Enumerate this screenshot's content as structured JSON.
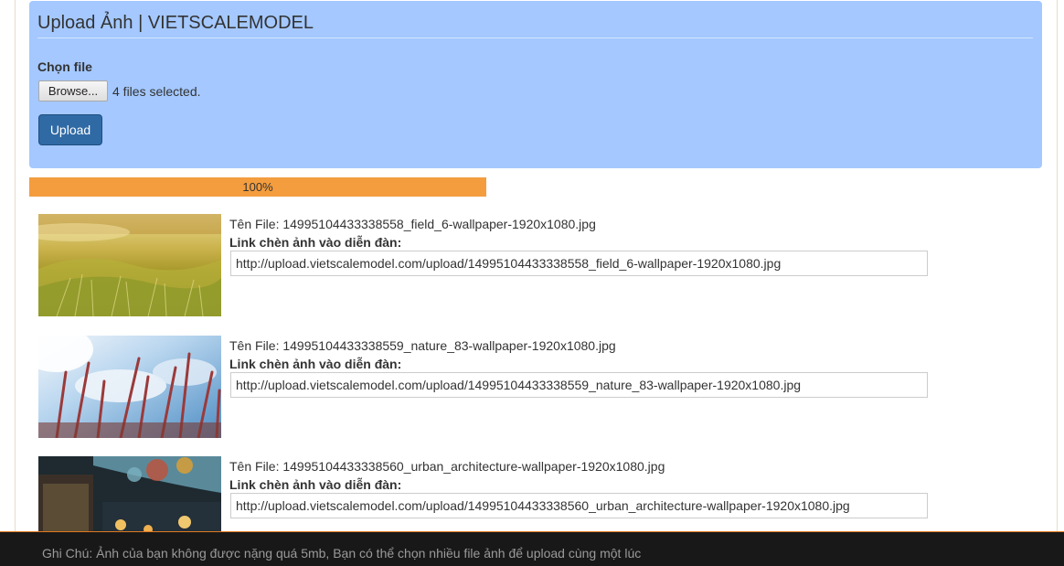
{
  "panel": {
    "title": "Upload Ảnh | VIETSCALEMODEL",
    "file_label": "Chọn file",
    "browse_label": "Browse...",
    "file_status": "4 files selected.",
    "upload_label": "Upload",
    "background_color": "#a4c8ff"
  },
  "progress": {
    "value": 1.0,
    "text": "100%",
    "color": "#f49d3f"
  },
  "files": [
    {
      "name_text": "Tên File: 14995104433338558_field_6-wallpaper-1920x1080.jpg",
      "link_label": "Link chèn ảnh vào diễn đàn:",
      "link": "http://upload.vietscalemodel.com/upload/14995104433338558_field_6-wallpaper-1920x1080.jpg"
    },
    {
      "name_text": "Tên File: 14995104433338559_nature_83-wallpaper-1920x1080.jpg",
      "link_label": "Link chèn ảnh vào diễn đàn:",
      "link": "http://upload.vietscalemodel.com/upload/14995104433338559_nature_83-wallpaper-1920x1080.jpg"
    },
    {
      "name_text": "Tên File: 14995104433338560_urban_architecture-wallpaper-1920x1080.jpg",
      "link_label": "Link chèn ảnh vào diễn đàn:",
      "link": "http://upload.vietscalemodel.com/upload/14995104433338560_urban_architecture-wallpaper-1920x1080.jpg"
    }
  ],
  "footer": {
    "note": "Ghi Chú: Ảnh của bạn không được nặng quá 5mb, Bạn có thể chọn nhiều file ảnh để upload cùng một lúc"
  }
}
